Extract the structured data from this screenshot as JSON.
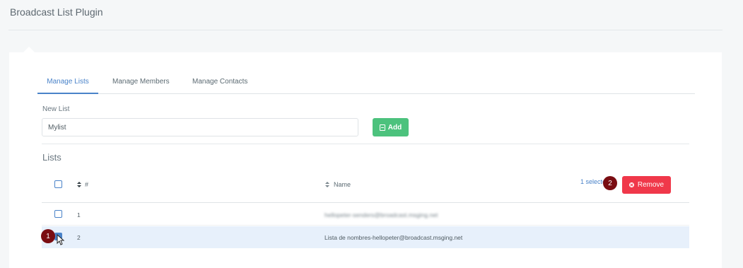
{
  "header": {
    "title": "Broadcast List Plugin"
  },
  "tabs": [
    {
      "label": "Manage Lists",
      "active": true
    },
    {
      "label": "Manage Members",
      "active": false
    },
    {
      "label": "Manage Contacts",
      "active": false
    }
  ],
  "form": {
    "new_list_label": "New List",
    "list_name_value": "Mylist",
    "add_label": "Add"
  },
  "lists": {
    "title": "Lists",
    "columns": {
      "id": "#",
      "name": "Name"
    },
    "selected_text": "1 selected",
    "remove_label": "Remove",
    "rows": [
      {
        "id": "1",
        "name": "hellopeter-senders@broadcast.msging.net",
        "blurred": true,
        "checked": false
      },
      {
        "id": "2",
        "name": "Lista de nombres-hellopeter@broadcast.msging.net",
        "blurred": false,
        "checked": true
      }
    ]
  },
  "annotations": {
    "step1": "1",
    "step2": "2"
  },
  "colors": {
    "accent": "#4a83c9",
    "add": "#4cc27d",
    "remove": "#f0384a",
    "badge": "#7a0d12",
    "selected_row": "#e7f0fb"
  }
}
